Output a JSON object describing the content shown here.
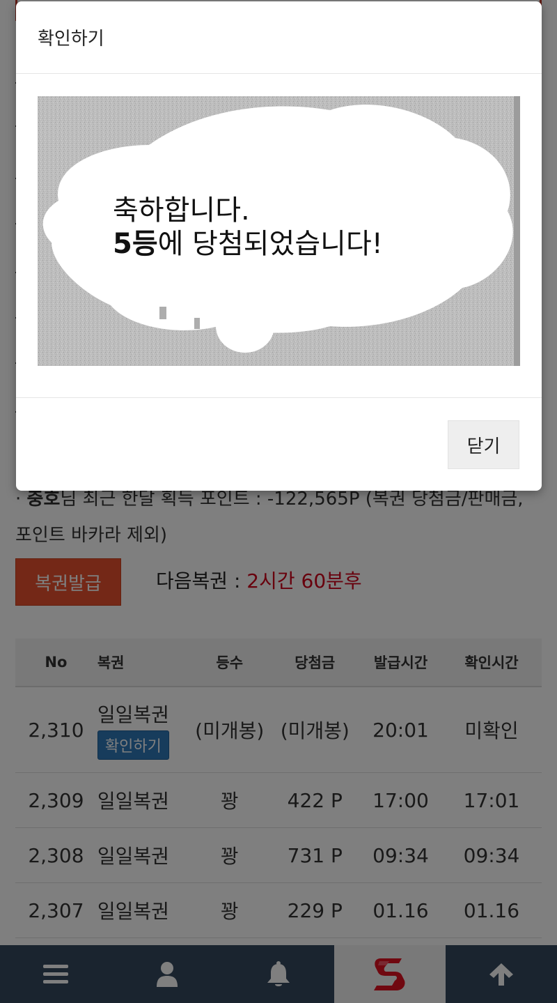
{
  "modal": {
    "title": "확인하기",
    "message_line1": "축하합니다.",
    "message_rank": "5등",
    "message_line2_rest": "에 당첨되었습니다!",
    "close_label": "닫기"
  },
  "info": {
    "user_name": "충호",
    "text": "님 최근 한달 획득 포인트 : -122,565P (복권 당첨금/판매금, 포인트 바카라 제외)"
  },
  "issue_button": {
    "label": "복권발급"
  },
  "next_lotto": {
    "label": "다음복권 : ",
    "value": "2시간 60분후"
  },
  "table": {
    "headers": [
      "No",
      "복권",
      "등수",
      "당첨금",
      "발급시간",
      "확인시간"
    ],
    "rows": [
      {
        "no": "2,310",
        "name": "일일복권",
        "action": "확인하기",
        "rank": "(미개봉)",
        "prize": "(미개봉)",
        "issued": "20:01",
        "checked": "미확인"
      },
      {
        "no": "2,309",
        "name": "일일복권",
        "rank": "꽝",
        "prize": "422 P",
        "issued": "17:00",
        "checked": "17:01"
      },
      {
        "no": "2,308",
        "name": "일일복권",
        "rank": "꽝",
        "prize": "731 P",
        "issued": "09:34",
        "checked": "09:34"
      },
      {
        "no": "2,307",
        "name": "일일복권",
        "rank": "꽝",
        "prize": "229 P",
        "issued": "01.16",
        "checked": "01.16"
      }
    ]
  },
  "bottom_nav": [
    {
      "icon": "menu-icon"
    },
    {
      "icon": "user-icon"
    },
    {
      "icon": "bell-icon"
    },
    {
      "icon": "brand-s-logo-icon",
      "active": true
    },
    {
      "icon": "arrow-up-icon"
    }
  ],
  "colors": {
    "accent_red": "#e8502e",
    "next_value": "#d0021b",
    "chip_blue": "#2f78b8",
    "unconfirmed": "#e0a000",
    "nav_bg": "#34495e"
  }
}
